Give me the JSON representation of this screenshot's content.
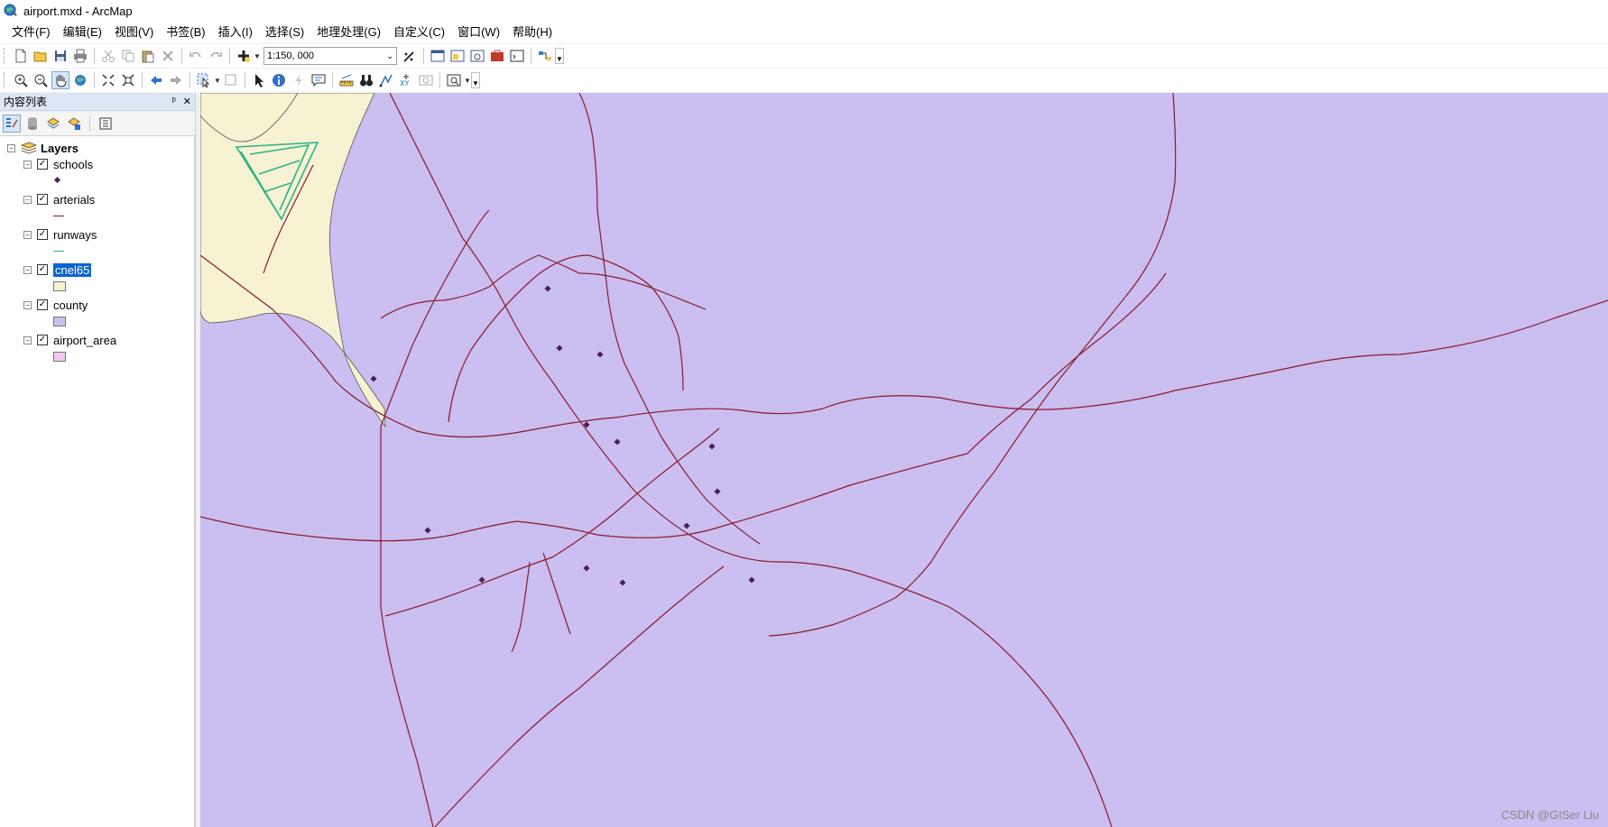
{
  "window": {
    "title": "airport.mxd - ArcMap"
  },
  "menu": [
    "文件(F)",
    "编辑(E)",
    "视图(V)",
    "书签(B)",
    "插入(I)",
    "选择(S)",
    "地理处理(G)",
    "自定义(C)",
    "窗口(W)",
    "帮助(H)"
  ],
  "toolbar": {
    "scale": "1:150, 000"
  },
  "toc": {
    "title": "内容列表",
    "pin_glyph": "ᵖ",
    "close_glyph": "✕",
    "root": "Layers",
    "layers": [
      {
        "name": "schools",
        "symbol": "point",
        "color": "#4b1f5c",
        "checked": true,
        "selected": false
      },
      {
        "name": "arterials",
        "symbol": "line",
        "color": "#8b1a2e",
        "checked": true,
        "selected": false
      },
      {
        "name": "runways",
        "symbol": "line",
        "color": "#2bb48a",
        "checked": true,
        "selected": false
      },
      {
        "name": "cnel65",
        "symbol": "fill",
        "color": "#f7f2d2",
        "checked": true,
        "selected": true
      },
      {
        "name": "county",
        "symbol": "fill",
        "color": "#cbbef0",
        "checked": true,
        "selected": false
      },
      {
        "name": "airport_area",
        "symbol": "fill",
        "color": "#f0c8f5",
        "checked": true,
        "selected": false
      }
    ]
  },
  "map": {
    "county_color": "#cbbef0",
    "cnel65_color": "#f7f2d2",
    "road_color": "#8b1a2e",
    "runway_color": "#2bb48a",
    "school_color": "#4b1f5c"
  },
  "watermark": "CSDN @GISer Liu"
}
